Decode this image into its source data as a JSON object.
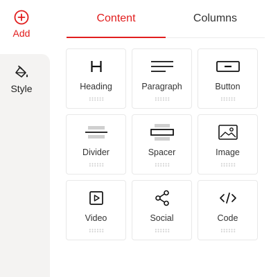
{
  "sidebar": {
    "items": [
      {
        "label": "Add",
        "icon": "plus-circle-icon",
        "active": true
      },
      {
        "label": "Style",
        "icon": "paint-bucket-icon",
        "active": false
      }
    ]
  },
  "tabs": [
    {
      "label": "Content",
      "active": true
    },
    {
      "label": "Columns",
      "active": false
    }
  ],
  "blocks": [
    {
      "label": "Heading",
      "icon": "heading-icon"
    },
    {
      "label": "Paragraph",
      "icon": "paragraph-icon"
    },
    {
      "label": "Button",
      "icon": "button-icon"
    },
    {
      "label": "Divider",
      "icon": "divider-icon"
    },
    {
      "label": "Spacer",
      "icon": "spacer-icon"
    },
    {
      "label": "Image",
      "icon": "image-icon"
    },
    {
      "label": "Video",
      "icon": "video-icon"
    },
    {
      "label": "Social",
      "icon": "share-icon"
    },
    {
      "label": "Code",
      "icon": "code-icon"
    }
  ],
  "colors": {
    "accent": "#e11d1d",
    "rail_background": "#f4f3f2",
    "card_border": "#e8e8e8"
  }
}
